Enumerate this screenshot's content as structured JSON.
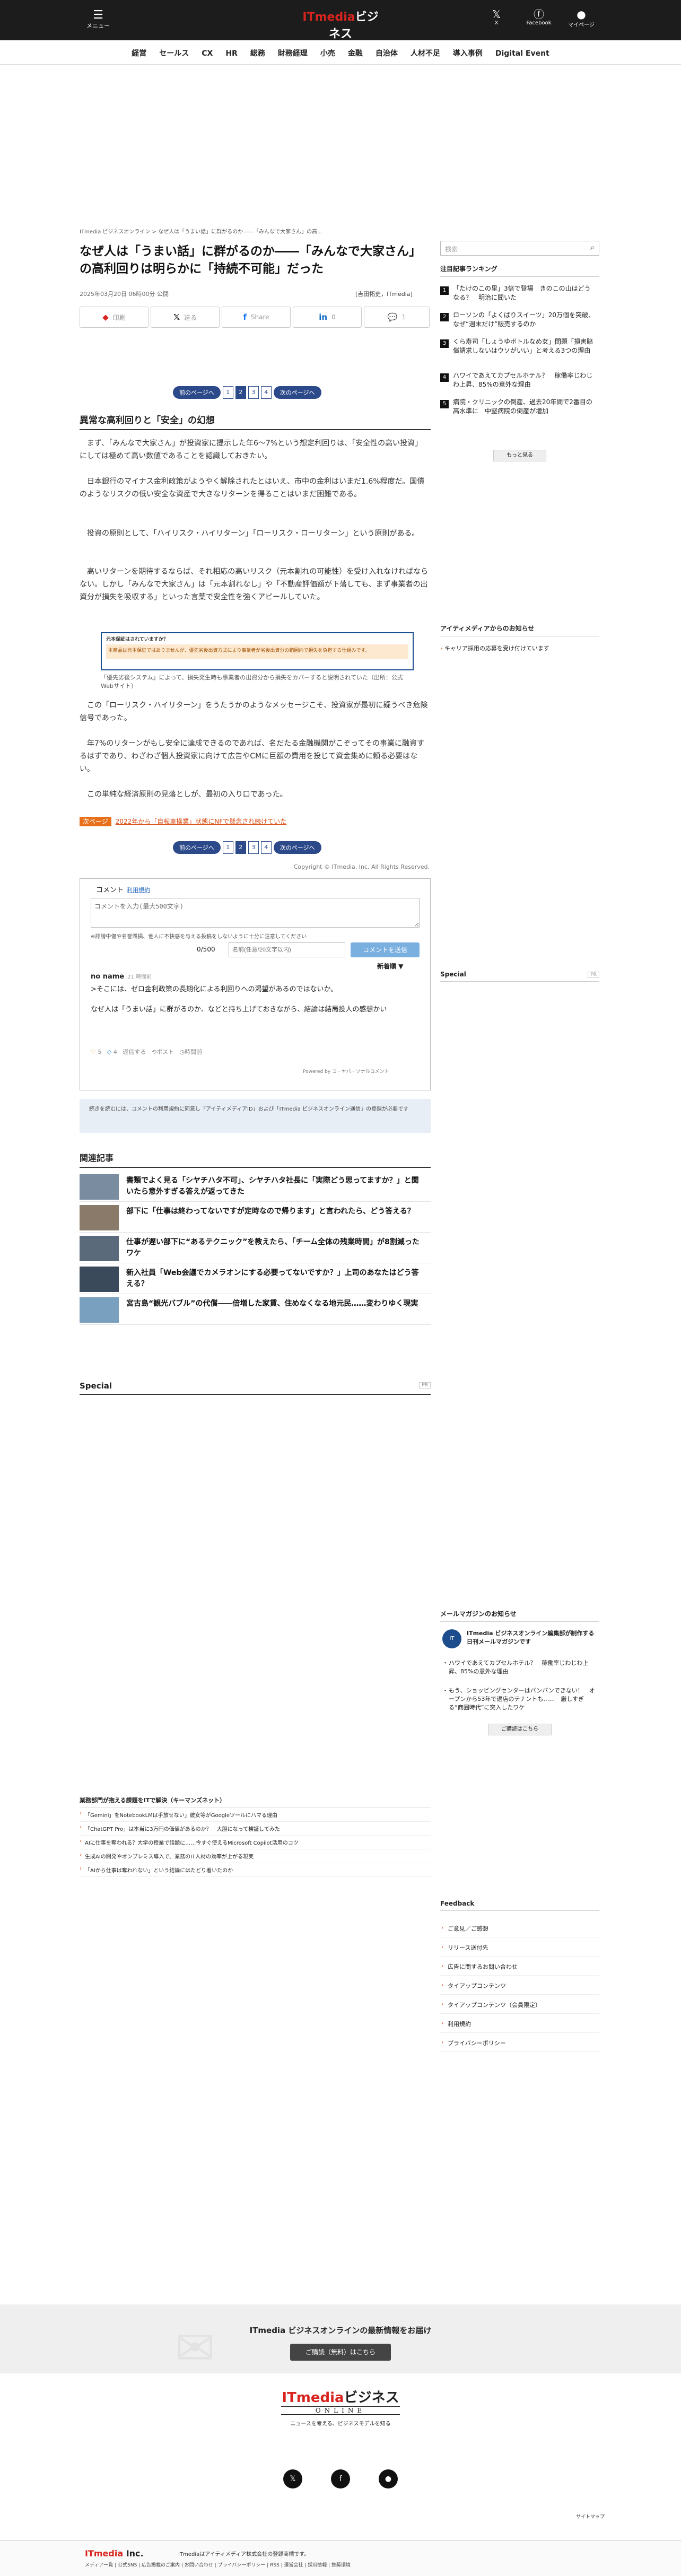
{
  "header": {
    "menu_label": "メニュー",
    "logo_main": "ITmedia",
    "logo_sub": "ビジネス",
    "logo_online": "ONLINE",
    "x_label": "X",
    "facebook_label": "Facebook",
    "mypage_label": "マイページ"
  },
  "nav": [
    "経営",
    "セールス",
    "CX",
    "HR",
    "総務",
    "財務経理",
    "小売",
    "金融",
    "自治体",
    "人材不足",
    "導入事例",
    "Digital Event"
  ],
  "breadcrumb": "ITmedia ビジネスオンライン > なぜ人は「うまい話」に群がるのか――「みんなで大家さん」の高...",
  "article": {
    "title": "なぜ人は「うまい話」に群がるのか――「みんなで大家さん」の高利回りは明らかに「持続不可能」だった",
    "date": "2025年03月20日 06時00分 公開",
    "byline": "[吉田拓史，ITmedia]",
    "share": [
      {
        "icon": "pocket-icon",
        "glyph": "◆",
        "label": "印刷"
      },
      {
        "icon": "x-icon",
        "glyph": "𝕏",
        "label": "送る"
      },
      {
        "icon": "facebook-icon",
        "glyph": "f",
        "label": "Share"
      },
      {
        "icon": "linkedin-icon",
        "glyph": "in",
        "label": "0"
      },
      {
        "icon": "comment-icon",
        "glyph": "💬",
        "label": "1"
      }
    ],
    "pager": {
      "prev": "前のページへ",
      "next": "次のページへ",
      "pages": [
        "1",
        "2",
        "3",
        "4"
      ],
      "current": "2"
    },
    "section_title": "異常な高利回りと「安全」の幻想",
    "paragraphs": [
      "まず、「みんなで大家さん」が投資家に提示した年6〜7%という想定利回りは、「安全性の高い投資」にしては極めて高い数値であることを認識しておきたい。",
      "日本銀行のマイナス金利政策がようやく解除されたとはいえ、市中の金利はいまだ1.6%程度だ。国債のようなリスクの低い安全な資産で大きなリターンを得ることはいまだ困難である。",
      "投資の原則として、「ハイリスク・ハイリターン」「ローリスク・ローリターン」という原則がある。",
      "高いリターンを期待するならば、それ相応の高いリスク（元本割れの可能性）を受け入れなければならない。しかし「みんなで大家さん」は「元本割れなし」や「不動産評価額が下落しても、まず事業者の出資分が損失を吸収する」といった言葉で安全性を強くアピールしていた。"
    ],
    "figure": {
      "head": "元本保証はされていますか？",
      "body": "本商品は元本保証ではありませんが、優先劣後出資方式により事業者が劣後出資分の範囲内で損失を負担する仕組みです。"
    },
    "caption": "「優先劣後システム」によって、損失発生時も事業者の出資分から損失をカバーすると説明されていた（出所：公式Webサイト）",
    "paragraphs2": [
      "この「ローリスク・ハイリターン」をうたうかのようなメッセージこそ、投資家が最初に疑うべき危険信号であった。",
      "年7%のリターンがもし安全に達成できるのであれば、名だたる金融機関がこぞってその事業に融資するはずであり、わざわざ個人投資家に向けて広告やCMに巨額の費用を投じて資金集めに頼る必要はない。",
      "この単純な経済原則の見落としが、最初の入り口であった。"
    ],
    "next_tag": "次ページ",
    "next_link": "2022年から「自転車操業」状態にNFで懸念され続けていた",
    "copyright": "Copyright © ITmedia, Inc. All Rights Reserved."
  },
  "comments": {
    "heading": "コメント",
    "rules_link": "利用規約",
    "placeholder": "コメントを入力(最大500文字)",
    "note": "※誹謗中傷や名誉毀損、他人に不快感を与える投稿をしないように十分に注意してください",
    "count": "0/500",
    "name_placeholder": "名前(任意/20文字以内)",
    "send": "コメントを送信",
    "sort": "新着順 ▼",
    "items": [
      {
        "user": "no name",
        "time": "21 時間前",
        "text1": ">そこには、ゼロ金利政策の長期化による利回りへの渇望があるのではないか。",
        "text2": "なぜ人は「うまい話」に群がるのか、などと持ち上げておきながら、結論は結局投人の感想かい",
        "likes": "5",
        "agree": "4",
        "reply": "返信する",
        "report": "ポスト",
        "thread": "時間前"
      }
    ],
    "powered": "Powered by コーヤパーソナルコメント"
  },
  "notice": "続きを読むには、コメントの利用規約に同意し「アイティメディアID」および「ITmedia ビジネスオンライン通信」の登録が必要です",
  "related": {
    "heading": "関連記事",
    "items": [
      "書類でよく見る「シヤチハタ不可」、シヤチハタ社長に「実際どう思ってますか？」と聞いたら意外すぎる答えが返ってきた",
      "部下に「仕事は終わってないですが定時なので帰ります」と言われたら、どう答える？",
      "仕事が遅い部下に“あるテクニック”を教えたら、「チーム全体の残業時間」が8割減ったワケ",
      "新入社員「Web会議でカメラオンにする必要ってないですか？」上司のあなたはどう答える？",
      "宮古島“観光バブル”の代償――倍増した家賃、住めなくなる地元民……変わりゆく現実"
    ]
  },
  "special": {
    "heading": "Special",
    "tag": "PR"
  },
  "lower_box": {
    "heading": "業務部門が抱える課題をITで解決（キーマンズネット）",
    "items": [
      "「Gemini」をNotebookLMは手放せない」彼女等がGoogleツールにハマる理由",
      "「ChatGPT Pro」は本当に3万円の価値があるのか？　大胆になって検証してみた",
      "AIに仕事を奪われる？大学の授業で話題に……今すぐ使えるMicrosoft Copilot活用のコツ",
      "生成AIの開発やオンプレミス導入で、業務のIT人材の効率が上がる現実",
      "「AIから仕事は奪われない」という結論にはたどり着いたのか"
    ]
  },
  "sidebar": {
    "search_placeholder": "検索",
    "ranking_heading": "注目記事ランキング",
    "ranking": [
      {
        "no": "1",
        "text": "「たけのこの里」3倍で登場　きのこの山はどうなる？　明治に聞いた"
      },
      {
        "no": "2",
        "text": "ローソンの「よくばりスイーツ」20万個を突破、なぜ“週末だけ”販売するのか"
      },
      {
        "no": "3",
        "text": "くら寿司「しょうゆボトルなめ女」問題「損害賠償請求しないはウソがいい」と考える3つの理由"
      },
      {
        "no": "4",
        "text": "ハワイであえてカプセルホテル？　稼働率じわじわ上昇、85%の意外な理由"
      },
      {
        "no": "5",
        "text": "病院・クリニックの倒産、過去20年間で2番目の高水準に　中堅病院の倒産が増加"
      }
    ],
    "more": "もっと見る",
    "ad_heading": "アイティメディアからのお知らせ",
    "ad_item": "キャリア採用の応募を受け付けています",
    "special_heading": "Special",
    "special_tag": "PR",
    "mm_heading": "メールマガジンのお知らせ",
    "mm_logo": "IT",
    "mm_title": "ITmedia ビジネスオンライン編集部が制作する日刊メールマガジンです",
    "mm_items": [
      "ハワイであえてカプセルホテル？　稼働率じわじわ上昇、85%の意外な理由",
      "もう、ショッピングセンターはバンバンできない！　オープンから53年で退店のテナントも……　厳しすぎる“商圏時代”に突入したワケ"
    ],
    "mm_btn": "ご購読はこちら",
    "fb_heading": "Feedback",
    "fb_items": [
      "ご意見／ご感想",
      "リリース送付先",
      "広告に関するお問い合わせ",
      "タイアップコンテンツ",
      "タイアップコンテンツ（会員限定）",
      "利用規約",
      "プライバシーポリシー"
    ]
  },
  "newsletter": {
    "text": "ITmedia ビジネスオンラインの最新情報をお届け",
    "button": "ご購読（無料）はこちら"
  },
  "footer": {
    "logo_main": "ITmedia",
    "logo_sub": "ビジネス",
    "logo_online": "ONLINE",
    "tagline": "ニュースを考える、ビジネスモデルを知る",
    "sitemap": "サイトマップ",
    "corp_logo": "ITmedia",
    "corp_suffix": "Inc.",
    "corp_desc": "ITmediaはアイティメディア株式会社の登録商標です。",
    "corp_links": "メディア一覧 | 公式SNS | 広告掲載のご案内 | お問い合わせ | プライバシーポリシー | RSS | 運営会社 | 採用情報 | 推奨環境"
  }
}
